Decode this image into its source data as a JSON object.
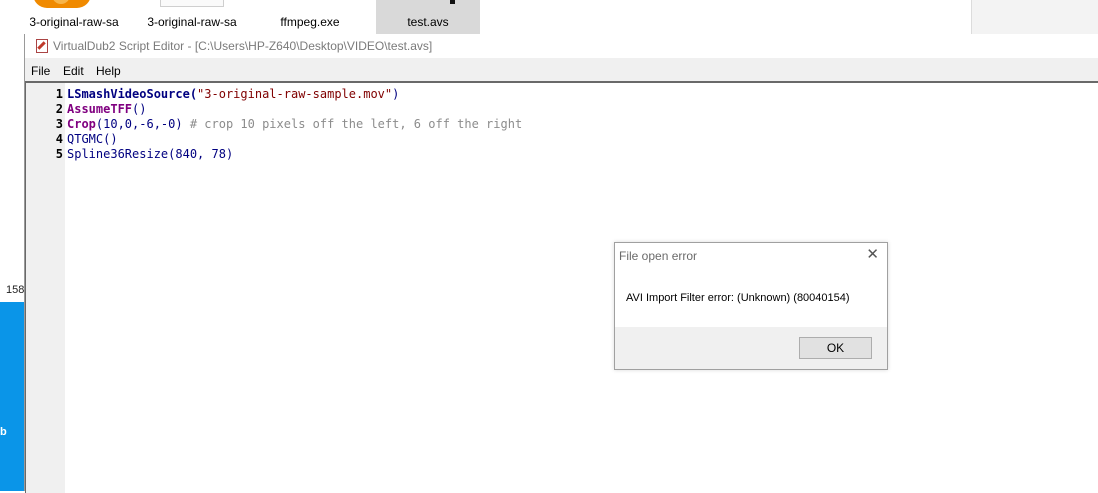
{
  "desktop": {
    "icons": [
      {
        "label": "3-original-raw-sa"
      },
      {
        "label": "3-original-raw-sa"
      },
      {
        "label": "ffmpeg.exe"
      },
      {
        "label": "test.avs"
      }
    ],
    "left_number": "158",
    "left_letter": "b"
  },
  "editor": {
    "title": "VirtualDub2 Script Editor - [C:\\Users\\HP-Z640\\Desktop\\VIDEO\\test.avs]",
    "menu": {
      "file": "File",
      "edit": "Edit",
      "help": "Help"
    },
    "lines": [
      {
        "num": "1",
        "parts": [
          {
            "t": "LSmashVideoSource(",
            "c": "fn"
          },
          {
            "t": "\"3-original-raw-sample.mov\"",
            "c": "str"
          },
          {
            "t": ")",
            "c": "txt"
          }
        ]
      },
      {
        "num": "2",
        "parts": [
          {
            "t": "AssumeTFF",
            "c": "kw"
          },
          {
            "t": "()",
            "c": "txt"
          }
        ]
      },
      {
        "num": "3",
        "parts": [
          {
            "t": "Crop",
            "c": "kw"
          },
          {
            "t": "(10,0,-6,-0)",
            "c": "num"
          },
          {
            "t": " # crop 10 pixels off the left, 6 off the right",
            "c": "cmt"
          }
        ]
      },
      {
        "num": "4",
        "parts": [
          {
            "t": "QTGMC()",
            "c": "txt"
          }
        ]
      },
      {
        "num": "5",
        "parts": [
          {
            "t": "Spline36Resize(840, 78)",
            "c": "txt"
          }
        ]
      }
    ]
  },
  "dialog": {
    "title": "File open error",
    "close_glyph": "✕",
    "message": "AVI Import Filter error: (Unknown) (80040154)",
    "ok_label": "OK"
  }
}
